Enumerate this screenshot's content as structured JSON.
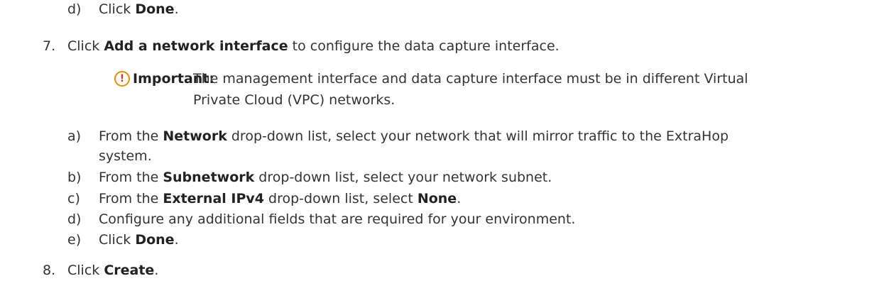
{
  "steps": {
    "d_top": {
      "marker": "d)",
      "prefix": "Click ",
      "bold": "Done",
      "suffix": "."
    },
    "step7": {
      "marker": "7.",
      "prefix": "Click ",
      "bold": "Add a network interface",
      "suffix": " to configure the data capture interface."
    },
    "important": {
      "icon": "important-icon",
      "label": "Important:",
      "line1": "The management interface and data capture interface must be in different Virtual",
      "line2": "Private Cloud (VPC) networks."
    },
    "a": {
      "marker": "a)",
      "prefix": "From the ",
      "bold": "Network",
      "suffix": " drop-down list, select your network that will mirror traffic to the ExtraHop",
      "cont": "system."
    },
    "b": {
      "marker": "b)",
      "prefix": "From the ",
      "bold": "Subnetwork",
      "suffix": " drop-down list, select your network subnet."
    },
    "c": {
      "marker": "c)",
      "prefix": "From the ",
      "bold": "External IPv4",
      "middle": " drop-down list, select ",
      "bold2": "None",
      "suffix": "."
    },
    "d": {
      "marker": "d)",
      "text": "Configure any additional fields that are required for your environment."
    },
    "e": {
      "marker": "e)",
      "prefix": "Click ",
      "bold": "Done",
      "suffix": "."
    },
    "step8": {
      "marker": "8.",
      "prefix": "Click ",
      "bold": "Create",
      "suffix": "."
    }
  }
}
